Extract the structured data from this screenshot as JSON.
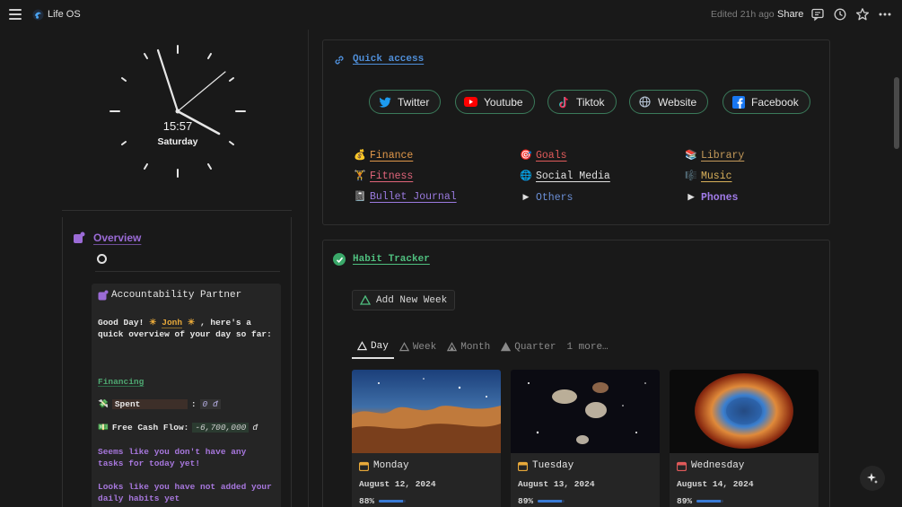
{
  "topbar": {
    "app_title": "Life OS",
    "edited": "Edited 21h ago",
    "share": "Share"
  },
  "clock": {
    "time": "15:57",
    "day": "Saturday"
  },
  "overview": {
    "title": "Overview",
    "partner_title": "Accountability Partner",
    "greeting_pre": "Good Day!",
    "greeting_name": "Jonh",
    "greeting_post": ", here's a quick overview of your day so far:",
    "financing": "Financing",
    "spent_label": "Spent",
    "spent_sep": ":",
    "spent_value": "0 đ",
    "cash_label": "Free Cash Flow:",
    "cash_value": "-6,700,000",
    "cash_unit": "đ",
    "msg_tasks": "Seems like you don't have any tasks for today yet!",
    "msg_habits": "Looks like you have not added your daily habits yet"
  },
  "quick_access": {
    "title": "Quick access",
    "socials": [
      {
        "label": "Twitter",
        "color": "#1d9bf0"
      },
      {
        "label": "Youtube",
        "color": "#ff0000"
      },
      {
        "label": "Tiktok",
        "color": "#ff2d55"
      },
      {
        "label": "Website",
        "color": "#8ab4f8"
      },
      {
        "label": "Facebook",
        "color": "#1877f2"
      }
    ],
    "links": {
      "finance": "Finance",
      "goals": "Goals",
      "library": "Library",
      "fitness": "Fitness",
      "social_media": "Social Media",
      "music": "Music",
      "bullet_journal": "Bullet Journal",
      "others": "Others",
      "phones": "Phones"
    }
  },
  "habit_tracker": {
    "title": "Habit Tracker",
    "add_week": "Add New Week",
    "tabs": [
      "Day",
      "Week",
      "Month",
      "Quarter"
    ],
    "more": "1 more…",
    "days": [
      {
        "day": "Monday",
        "date": "August 12, 2024",
        "pct": "88%",
        "progress": 0.88
      },
      {
        "day": "Tuesday",
        "date": "August 13, 2024",
        "pct": "89%",
        "progress": 0.89
      },
      {
        "day": "Wednesday",
        "date": "August 14, 2024",
        "pct": "89%",
        "progress": 0.89
      }
    ]
  }
}
